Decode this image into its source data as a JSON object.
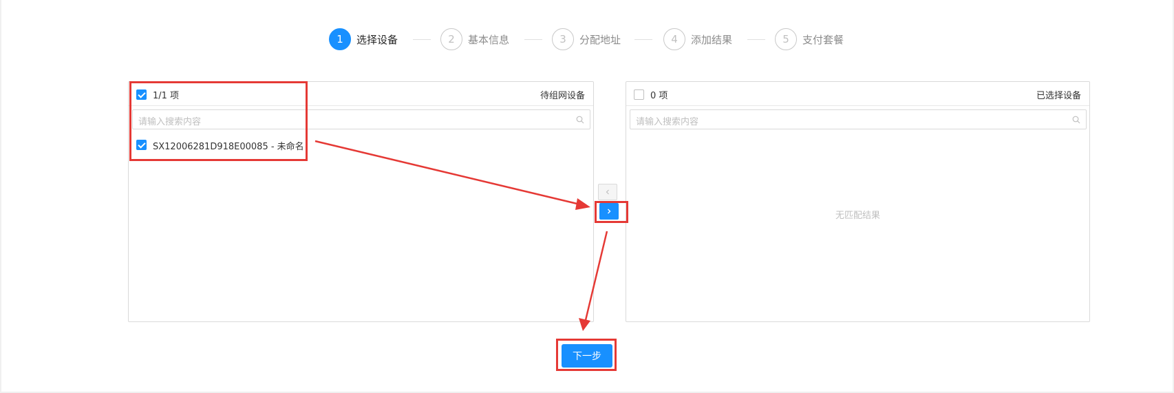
{
  "steps": [
    {
      "num": "1",
      "label": "选择设备",
      "active": true
    },
    {
      "num": "2",
      "label": "基本信息",
      "active": false
    },
    {
      "num": "3",
      "label": "分配地址",
      "active": false
    },
    {
      "num": "4",
      "label": "添加结果",
      "active": false
    },
    {
      "num": "5",
      "label": "支付套餐",
      "active": false
    }
  ],
  "source_panel": {
    "count": "1/1 项",
    "title": "待组网设备",
    "search_placeholder": "请输入搜索内容",
    "items": [
      {
        "label": "SX12006281D918E00085 - 未命名",
        "checked": true
      }
    ]
  },
  "target_panel": {
    "count": "0 项",
    "title": "已选择设备",
    "search_placeholder": "请输入搜索内容",
    "empty_text": "无匹配结果"
  },
  "next_button": "下一步",
  "colors": {
    "primary": "#1890ff",
    "annotation": "#e53935"
  }
}
